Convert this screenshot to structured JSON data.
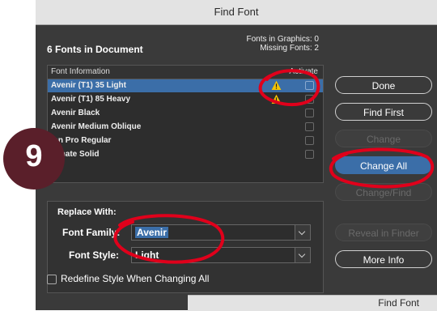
{
  "dialog": {
    "title": "Find Font",
    "fonts_count_label": "6 Fonts in Document",
    "fonts_in_graphics": "Fonts in Graphics: 0",
    "missing_fonts": "Missing Fonts: 2"
  },
  "font_list": {
    "header_font_information": "Font Information",
    "header_activate": "Activate",
    "rows": [
      {
        "name": "Avenir (T1) 35 Light"
      },
      {
        "name": "Avenir (T1) 85 Heavy"
      },
      {
        "name": "Avenir Black"
      },
      {
        "name": "Avenir Medium Oblique"
      },
      {
        "name": "ion Pro Regular"
      },
      {
        "name": "sphate Solid"
      }
    ]
  },
  "buttons": {
    "done": "Done",
    "find_first": "Find First",
    "change": "Change",
    "change_all": "Change All",
    "change_find": "Change/Find",
    "reveal_in_finder": "Reveal in Finder",
    "more_info": "More Info"
  },
  "replace": {
    "title": "Replace With:",
    "font_family_label": "Font Family:",
    "font_family_value": "Avenir",
    "font_style_label": "Font Style:",
    "font_style_value": "Light",
    "redefine_label": "Redefine Style When Changing All"
  },
  "second_window_title": "Find Font",
  "step_badge": "9",
  "colors": {
    "dialog_bg": "#3a3a3a",
    "selection": "#3b6ea8",
    "annotation": "#e0001b",
    "warning": "#f5c400",
    "badge": "#5a1f2a"
  }
}
